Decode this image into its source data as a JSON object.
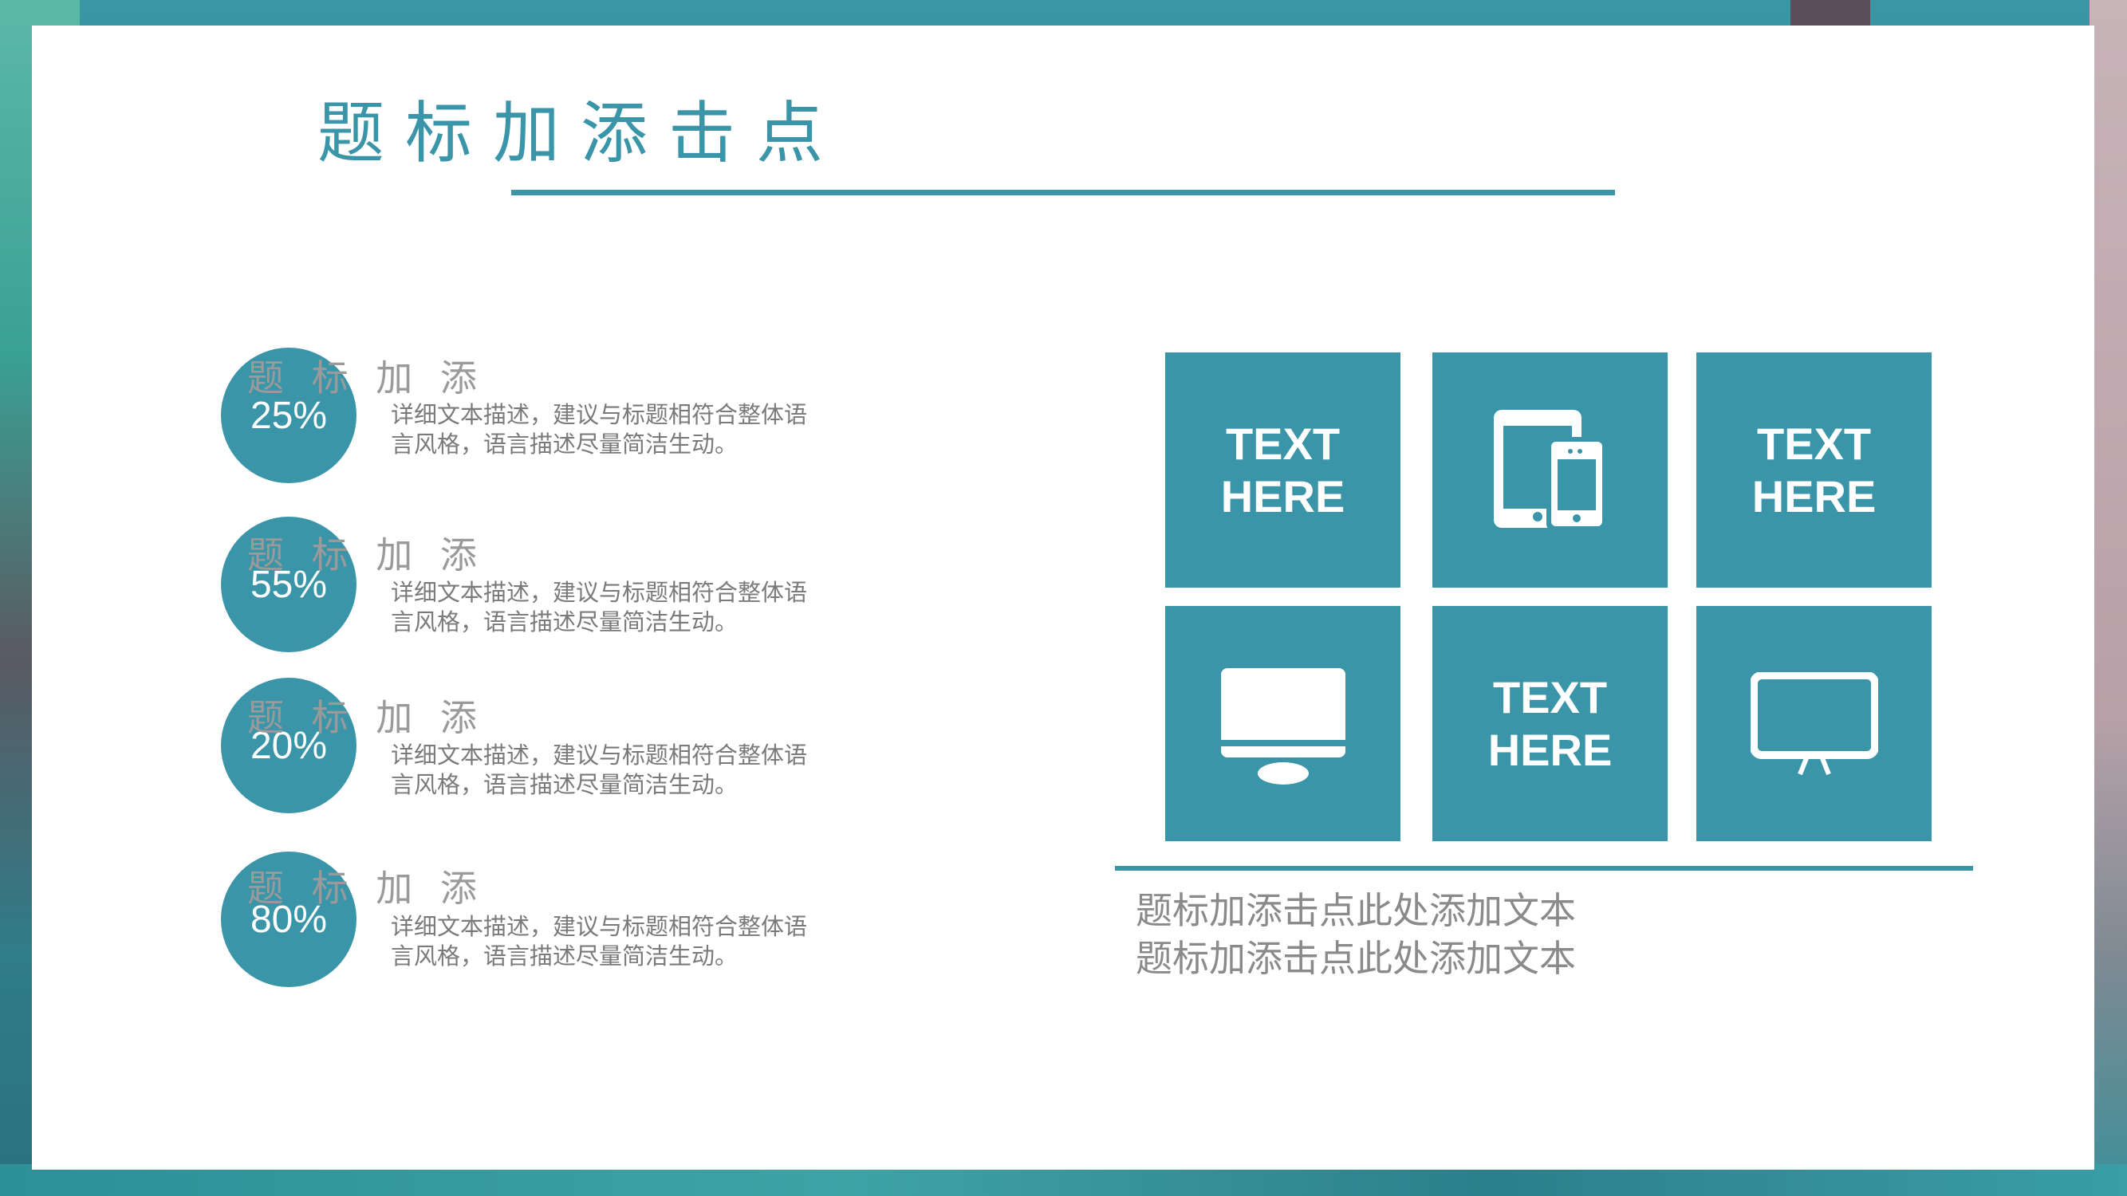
{
  "slide": {
    "title": "题标加添击点",
    "items": [
      {
        "percent": "25%",
        "heading": "题 标 加 添",
        "description": "详细文本描述，建议与标题相符合整体语言风格，语言描述尽量简洁生动。"
      },
      {
        "percent": "55%",
        "heading": "题 标 加 添",
        "description": "详细文本描述，建议与标题相符合整体语言风格，语言描述尽量简洁生动。"
      },
      {
        "percent": "20%",
        "heading": "题 标 加 添",
        "description": "详细文本描述，建议与标题相符合整体语言风格，语言描述尽量简洁生动。"
      },
      {
        "percent": "80%",
        "heading": "题 标 加 添",
        "description": "详细文本描述，建议与标题相符合整体语言风格，语言描述尽量简洁生动。"
      }
    ],
    "tiles": [
      {
        "line1": "TEXT",
        "line2": "HERE"
      },
      {
        "icon": "devices-icon"
      },
      {
        "line1": "TEXT",
        "line2": "HERE"
      },
      {
        "icon": "monitor-icon"
      },
      {
        "line1": "TEXT",
        "line2": "HERE"
      },
      {
        "icon": "presentation-board-icon"
      }
    ],
    "captions": [
      "题标加添击点此处添加文本",
      "题标加添击点此处添加文本"
    ]
  },
  "colors": {
    "accent": "#3a95a8",
    "text_gray": "#7a7a7a",
    "card": "#ffffff"
  }
}
